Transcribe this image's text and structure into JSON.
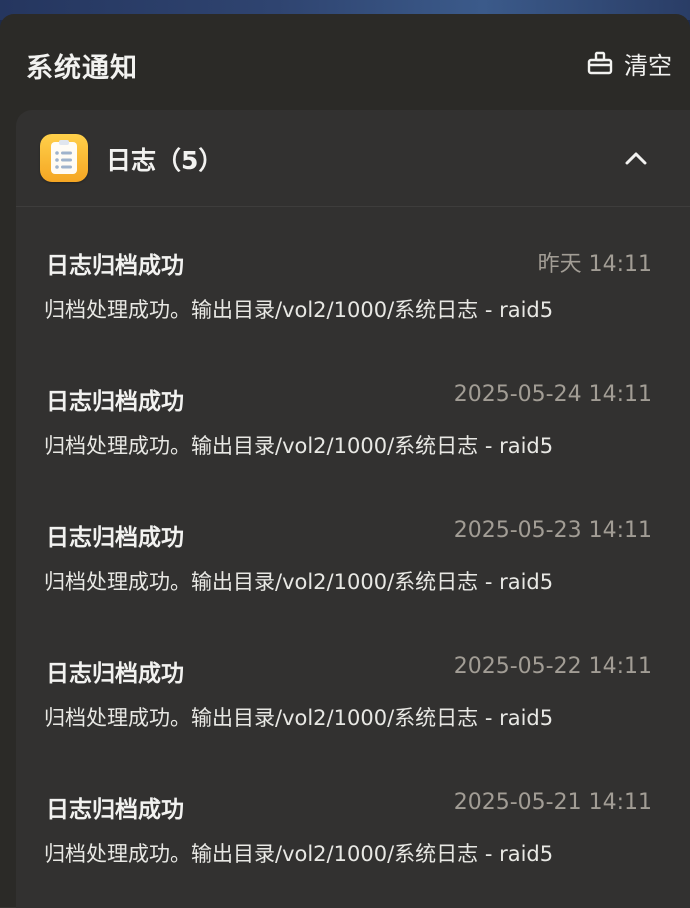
{
  "panel": {
    "title": "系统通知",
    "clear_label": "清空"
  },
  "group": {
    "title": "日志（5）",
    "icon": "log-app-icon"
  },
  "notifications": [
    {
      "title": "日志归档成功",
      "time": "昨天 14:11",
      "body": "归档处理成功。输出目录/vol2/1000/系统日志 - raid5"
    },
    {
      "title": "日志归档成功",
      "time": "2025-05-24 14:11",
      "body": "归档处理成功。输出目录/vol2/1000/系统日志 - raid5"
    },
    {
      "title": "日志归档成功",
      "time": "2025-05-23 14:11",
      "body": "归档处理成功。输出目录/vol2/1000/系统日志 - raid5"
    },
    {
      "title": "日志归档成功",
      "time": "2025-05-22 14:11",
      "body": "归档处理成功。输出目录/vol2/1000/系统日志 - raid5"
    },
    {
      "title": "日志归档成功",
      "time": "2025-05-21 14:11",
      "body": "归档处理成功。输出目录/vol2/1000/系统日志 - raid5"
    }
  ],
  "colors": {
    "panel_bg": "#2b2a27",
    "card_bg": "#323130",
    "accent_icon": "#f5a623",
    "time_text": "#a29d95"
  }
}
